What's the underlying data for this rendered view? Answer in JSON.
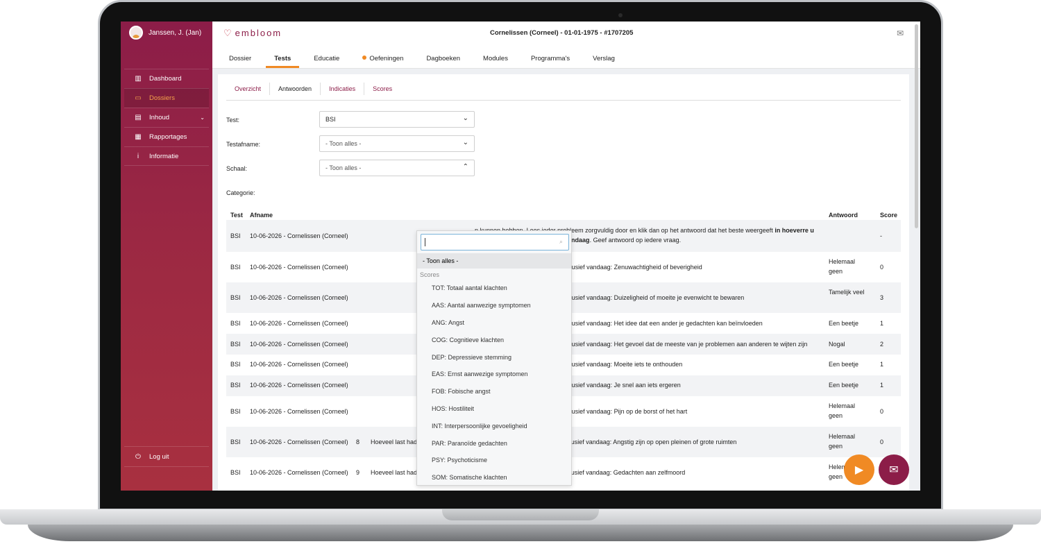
{
  "user": {
    "name": "Janssen, J. (Jan)"
  },
  "sidebar": {
    "items": [
      {
        "label": "Dashboard",
        "icon": "bar-chart-icon"
      },
      {
        "label": "Dossiers",
        "icon": "folder-icon"
      },
      {
        "label": "Inhoud",
        "icon": "content-icon"
      },
      {
        "label": "Rapportages",
        "icon": "report-icon"
      },
      {
        "label": "Informatie",
        "icon": "info-icon"
      }
    ],
    "logout": "Log uit"
  },
  "header": {
    "logo": "embloom",
    "patient": "Cornelissen (Corneel) - 01-01-1975 - #1707205",
    "tabs": [
      "Dossier",
      "Tests",
      "Educatie",
      "Oefeningen",
      "Dagboeken",
      "Modules",
      "Programma's",
      "Verslag"
    ]
  },
  "subtabs": [
    "Overzicht",
    "Antwoorden",
    "Indicaties",
    "Scores"
  ],
  "form": {
    "test_label": "Test:",
    "test_value": "BSI",
    "afname_label": "Testafname:",
    "afname_value": "- Toon alles -",
    "schaal_label": "Schaal:",
    "schaal_value": "- Toon alles -",
    "categorie_label": "Categorie:"
  },
  "dropdown": {
    "all": "- Toon alles -",
    "group": "Scores",
    "options": [
      "TOT: Totaal aantal klachten",
      "AAS: Aantal aanwezige symptomen",
      "ANG: Angst",
      "COG: Cognitieve klachten",
      "DEP: Depressieve stemming",
      "EAS: Ernst aanwezige symptomen",
      "FOB: Fobische angst",
      "HOS: Hostiliteit",
      "INT: Interpersoonlijke gevoeligheid",
      "PAR: Paranoïde gedachten",
      "PSY: Psychoticisme",
      "SOM: Somatische klachten"
    ]
  },
  "table": {
    "headers": {
      "test": "Test",
      "afname": "Afname",
      "antwoord": "Antwoord",
      "score": "Score"
    },
    "intro": {
      "test": "BSI",
      "afname": "10-06-2026 - Cornelissen (Corneel)",
      "text_a": "n kunnen hebben. Lees ieder probleem zorgvuldig door en klik dan op het antwoord dat het beste weergeeft",
      "text_bold_a": "in hoeverre u",
      "text_bold_b": "e de afgelopen week inclusief vandaag",
      "text_b": ". Geef antwoord op iedere vraag.",
      "score": "-"
    },
    "rows": [
      {
        "test": "BSI",
        "afname": "10-06-2026 - Cornelissen (Corneel)",
        "nr": "",
        "vraag": "gedurende de afgelopen week, inclusief vandaag: Zenuwachtigheid of beverigheid",
        "antwoord": "Helemaal geen",
        "score": "0"
      },
      {
        "test": "BSI",
        "afname": "10-06-2026 - Cornelissen (Corneel)",
        "nr": "",
        "vraag": "gedurende de afgelopen week, inclusief vandaag: Duizeligheid of moeite je evenwicht te bewaren",
        "antwoord": "Tamelijk veel",
        "score": "3"
      },
      {
        "test": "BSI",
        "afname": "10-06-2026 - Cornelissen (Corneel)",
        "nr": "",
        "vraag": "gedurende de afgelopen week, inclusief vandaag: Het idee dat een ander je gedachten kan beïnvloeden",
        "antwoord": "Een beetje",
        "score": "1"
      },
      {
        "test": "BSI",
        "afname": "10-06-2026 - Cornelissen (Corneel)",
        "nr": "",
        "vraag": "gedurende de afgelopen week, inclusief vandaag: Het gevoel dat de meeste van je problemen aan anderen te wijten zijn",
        "antwoord": "Nogal",
        "score": "2"
      },
      {
        "test": "BSI",
        "afname": "10-06-2026 - Cornelissen (Corneel)",
        "nr": "",
        "vraag": "gedurende de afgelopen week, inclusief vandaag: Moeite iets te onthouden",
        "antwoord": "Een beetje",
        "score": "1"
      },
      {
        "test": "BSI",
        "afname": "10-06-2026 - Cornelissen (Corneel)",
        "nr": "",
        "vraag": "gedurende de afgelopen week, inclusief vandaag: Je snel aan iets ergeren",
        "antwoord": "Een beetje",
        "score": "1"
      },
      {
        "test": "BSI",
        "afname": "10-06-2026 - Cornelissen (Corneel)",
        "nr": "",
        "vraag": "gedurende de afgelopen week, inclusief vandaag: Pijn op de borst of het hart",
        "antwoord": "Helemaal geen",
        "score": "0"
      },
      {
        "test": "BSI",
        "afname": "10-06-2026 - Cornelissen (Corneel)",
        "nr": "8",
        "vraag": "Hoeveel last had u van het probleem gedurende de afgelopen week, inclusief vandaag: Angstig zijn op open pleinen of grote ruimten",
        "antwoord": "Helemaal geen",
        "score": "0"
      },
      {
        "test": "BSI",
        "afname": "10-06-2026 - Cornelissen (Corneel)",
        "nr": "9",
        "vraag": "Hoeveel last had u van het probleem gedurende de afgelopen week, inclusief vandaag: Gedachten aan zelfmoord",
        "antwoord": "Helemaal geen",
        "score": ""
      }
    ]
  },
  "colors": {
    "brand": "#8c1d48",
    "accent": "#f08a24"
  }
}
